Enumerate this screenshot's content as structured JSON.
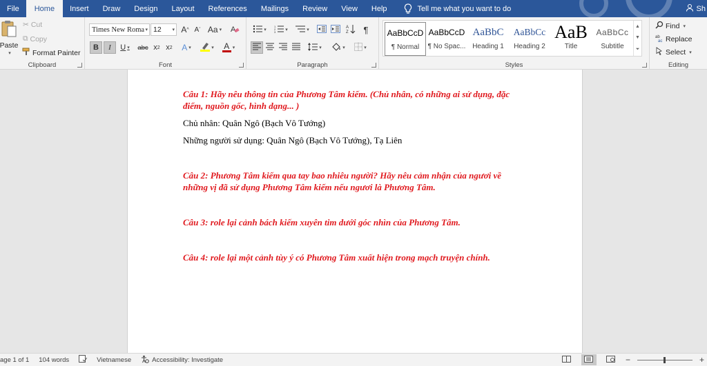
{
  "menubar": {
    "tabs": [
      {
        "label": "File"
      },
      {
        "label": "Home"
      },
      {
        "label": "Insert"
      },
      {
        "label": "Draw"
      },
      {
        "label": "Design"
      },
      {
        "label": "Layout"
      },
      {
        "label": "References"
      },
      {
        "label": "Mailings"
      },
      {
        "label": "Review"
      },
      {
        "label": "View"
      },
      {
        "label": "Help"
      }
    ],
    "active_tab": "Home",
    "tell_me": "Tell me what you want to do",
    "share": "Sh",
    "accent_color": "#2b579a"
  },
  "ribbon": {
    "clipboard": {
      "label": "Clipboard",
      "paste": "Paste",
      "cut": "Cut",
      "copy": "Copy",
      "format_painter": "Format Painter"
    },
    "font": {
      "label": "Font",
      "font_name": "Times New Roma",
      "font_size": "12",
      "change_case": "Aa",
      "grow": "A",
      "shrink": "A",
      "bold": "B",
      "italic": "I",
      "underline": "U",
      "strikethrough": "abc",
      "subscript": "x",
      "superscript": "x",
      "text_effects": "A",
      "font_color": "A",
      "font_color_hex": "#c00000",
      "highlight_hex": "#ffff00"
    },
    "paragraph": {
      "label": "Paragraph"
    },
    "styles": {
      "label": "Styles",
      "items": [
        {
          "preview": "AaBbCcD",
          "name": "¶ Normal"
        },
        {
          "preview": "AaBbCcD",
          "name": "¶ No Spac..."
        },
        {
          "preview": "AaBbC",
          "name": "Heading 1"
        },
        {
          "preview": "AaBbCc",
          "name": "Heading 2"
        },
        {
          "preview": "AaB",
          "name": "Title"
        },
        {
          "preview": "AaBbCc",
          "name": "Subtitle"
        }
      ]
    },
    "editing": {
      "label": "Editing",
      "find": "Find",
      "replace": "Replace",
      "select": "Select"
    }
  },
  "document": {
    "question_color": "#e0191e",
    "paragraphs": [
      {
        "type": "q",
        "text": "Câu 1: Hãy nêu thông tin của Phương Tâm kiếm. (Chủ nhân, có những ai sử dụng, đặc điểm, nguồn gốc, hình dạng... )"
      },
      {
        "type": "body",
        "text": "Chủ nhân: Quân Ngô (Bạch Vô Tướng)"
      },
      {
        "type": "body",
        "text": "Những người sử dụng: Quân Ngô (Bạch Vô Tướng), Tạ Liên"
      },
      {
        "type": "q",
        "text": "Câu 2: Phương Tâm kiếm qua tay bao nhiêu người? Hãy nêu cảm nhận của ngươi về những vị đã sử dụng Phương Tâm kiếm nếu ngươi là Phương Tâm."
      },
      {
        "type": "q",
        "text": "Câu 3: role lại cảnh bách kiếm xuyên tim dưới góc nhìn của Phương Tâm."
      },
      {
        "type": "q",
        "text": "Câu 4: role lại một cảnh tùy ý có Phương Tâm xuất hiện trong mạch truyện chính."
      }
    ]
  },
  "statusbar": {
    "page": "age 1 of 1",
    "words": "104 words",
    "language": "Vietnamese",
    "accessibility": "Accessibility: Investigate",
    "zoom_fraction": 0.5
  }
}
